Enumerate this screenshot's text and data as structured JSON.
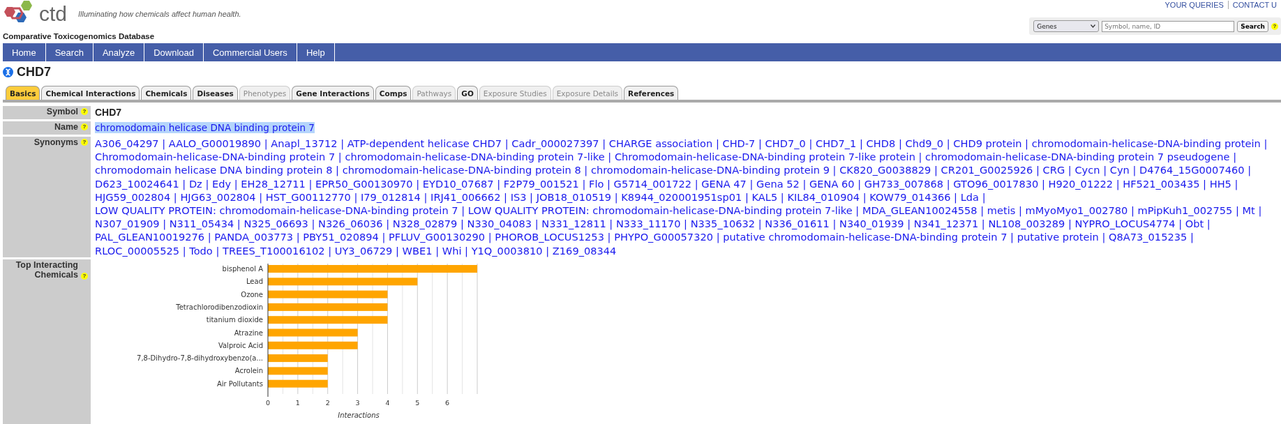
{
  "header": {
    "logo_text": "ctd",
    "tagline": "Illuminating how chemicals affect human health.",
    "site_name": "Comparative Toxicogenomics Database",
    "top_links": [
      "YOUR QUERIES",
      "CONTACT U"
    ],
    "search": {
      "category": "Genes",
      "placeholder": "Symbol, name, ID",
      "button": "Search",
      "help": "?"
    }
  },
  "nav": [
    "Home",
    "Search",
    "Analyze",
    "Download",
    "Commercial Users",
    "Help"
  ],
  "page_title": "CHD7",
  "tabs": [
    {
      "label": "Basics",
      "selected": true,
      "disabled": false
    },
    {
      "label": "Chemical Interactions",
      "selected": false,
      "disabled": false
    },
    {
      "label": "Chemicals",
      "selected": false,
      "disabled": false
    },
    {
      "label": "Diseases",
      "selected": false,
      "disabled": false
    },
    {
      "label": "Phenotypes",
      "selected": false,
      "disabled": true
    },
    {
      "label": "Gene Interactions",
      "selected": false,
      "disabled": false
    },
    {
      "label": "Comps",
      "selected": false,
      "disabled": false
    },
    {
      "label": "Pathways",
      "selected": false,
      "disabled": true
    },
    {
      "label": "GO",
      "selected": false,
      "disabled": false
    },
    {
      "label": "Exposure Studies",
      "selected": false,
      "disabled": true
    },
    {
      "label": "Exposure Details",
      "selected": false,
      "disabled": true
    },
    {
      "label": "References",
      "selected": false,
      "disabled": false
    }
  ],
  "fields": [
    {
      "kind": "symbol",
      "label": "Symbol",
      "help": "?",
      "value": "CHD7"
    },
    {
      "kind": "name",
      "label": "Name",
      "help": "?",
      "value": "chromodomain helicase DNA binding protein 7",
      "highlighted": true
    },
    {
      "kind": "links",
      "label": "Synonyms",
      "help": "?",
      "separator": "|",
      "links": [
        "A306_04297",
        "AALO_G00019890",
        "Anapl_13712",
        "ATP-dependent helicase CHD7",
        "Cadr_000027397",
        "CHARGE association",
        "CHD-7",
        "CHD7_0",
        "CHD7_1",
        "CHD8",
        "Chd9_0",
        "CHD9 protein",
        "chromodomain-helicase-DNA-binding protein",
        "Chromodomain-helicase-DNA-binding protein 7",
        "chromodomain-helicase-DNA-binding protein 7-like",
        "Chromodomain-helicase-DNA-binding protein 7-like protein",
        "chromodomain-helicase-DNA-binding protein 7 pseudogene",
        "chromodomain helicase DNA binding protein 8",
        "chromodomain-helicase-DNA-binding protein 8",
        "chromodomain-helicase-DNA-binding protein 9",
        "CK820_G0038829",
        "CR201_G0025926",
        "CRG",
        "Cycn",
        "Cyn",
        "D4764_15G0007460",
        "D623_10024641",
        "Dz",
        "Edy",
        "EH28_12711",
        "EPR50_G00130970",
        "EYD10_07687",
        "F2P79_001521",
        "Flo",
        "G5714_001722",
        "GENA 47",
        "Gena 52",
        "GENA 60",
        "GH733_007868",
        "GTO96_0017830",
        "H920_01222",
        "HF521_003435",
        "HH5",
        "HJG59_002804",
        "HJG63_002804",
        "HST_G00112770",
        "I79_012814",
        "IRJ41_006662",
        "IS3",
        "JOB18_010519",
        "K8944_020001951sp01",
        "KAL5",
        "KIL84_010904",
        "KOW79_014366",
        "Lda",
        "LOW QUALITY PROTEIN: chromodomain-helicase-DNA-binding protein 7",
        "LOW QUALITY PROTEIN: chromodomain-helicase-DNA-binding protein 7-like",
        "MDA_GLEAN10024558",
        "metis",
        "mMyoMyo1_002780",
        "mPipKuh1_002755",
        "Mt",
        "N307_01909",
        "N311_05434",
        "N325_06693",
        "N326_06036",
        "N328_02879",
        "N330_04083",
        "N331_12811",
        "N333_11170",
        "N335_10632",
        "N336_01611",
        "N340_01939",
        "N341_12371",
        "NL108_003289",
        "NYPRO_LOCUS4774",
        "Obt",
        "PAL_GLEAN10019276",
        "PANDA_003773",
        "PBY51_020894",
        "PFLUV_G00130290",
        "PHOROB_LOCUS1253",
        "PHYPO_G00057320",
        "putative chromodomain-helicase-DNA-binding protein 7",
        "putative protein",
        "Q8A73_015235",
        "RLOC_00005525",
        "Todo",
        "TREES_T100016102",
        "UY3_06729",
        "WBE1",
        "Whi",
        "Y1Q_0003810",
        "Z169_08344"
      ]
    },
    {
      "kind": "chart",
      "label": "Top Interacting Chemicals",
      "help": "?",
      "chart_data": {
        "type": "bar",
        "orientation": "horizontal",
        "xlabel": "Interactions",
        "categories": [
          "bisphenol A",
          "Lead",
          "Ozone",
          "Tetrachlorodibenzodioxin",
          "titanium dioxide",
          "Atrazine",
          "Valproic Acid",
          "7,8-Dihydro-7,8-dihydroxybenzo(a...",
          "Acrolein",
          "Air Pollutants"
        ],
        "grid": true,
        "series": [
          {
            "color": "#ffa500",
            "values": [
              7,
              5,
              4,
              4,
              4,
              3,
              3,
              2,
              2,
              2
            ]
          }
        ],
        "xlim": [
          0,
          7
        ],
        "xticks": [
          0,
          1,
          2,
          3,
          4,
          5,
          6
        ]
      }
    }
  ]
}
